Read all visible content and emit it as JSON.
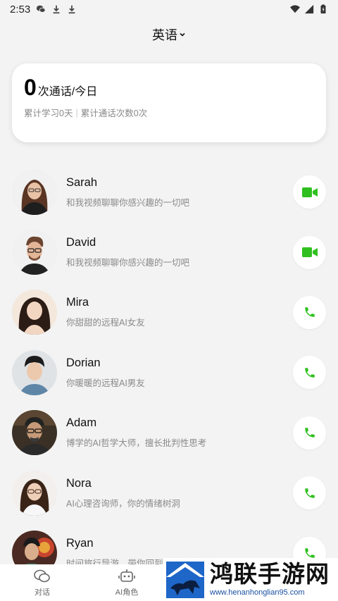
{
  "status_bar": {
    "time": "2:53"
  },
  "header": {
    "language": "英语"
  },
  "stats": {
    "count": "0",
    "count_label": "次通话/今日",
    "study_days": "累计学习0天",
    "separator": "|",
    "total_calls": "累计通话次数0次"
  },
  "contacts": [
    {
      "name": "Sarah",
      "desc": "和我视频聊聊你感兴趣的一切吧",
      "call_type": "video-icon"
    },
    {
      "name": "David",
      "desc": "和我视频聊聊你感兴趣的一切吧",
      "call_type": "video-icon"
    },
    {
      "name": "Mira",
      "desc": "你甜甜的远程AI女友",
      "call_type": "phone-icon"
    },
    {
      "name": "Dorian",
      "desc": "你暖暖的远程AI男友",
      "call_type": "phone-icon"
    },
    {
      "name": "Adam",
      "desc": "博学的AI哲学大师，擅长批判性思考",
      "call_type": "phone-icon"
    },
    {
      "name": "Nora",
      "desc": "AI心理咨询师，你的情绪树洞",
      "call_type": "phone-icon"
    },
    {
      "name": "Ryan",
      "desc": "时间旅行导游，带你回到任意时间地点",
      "call_type": "phone-icon"
    }
  ],
  "nav": [
    {
      "label": "对话",
      "icon": "chat-icon"
    },
    {
      "label": "AI角色",
      "icon": "robot-icon"
    }
  ],
  "watermark": {
    "title": "鸿联手游网",
    "url": "www.henanhonglian95.com"
  },
  "colors": {
    "accent": "#2fc01f",
    "background": "#f3f3f3"
  }
}
